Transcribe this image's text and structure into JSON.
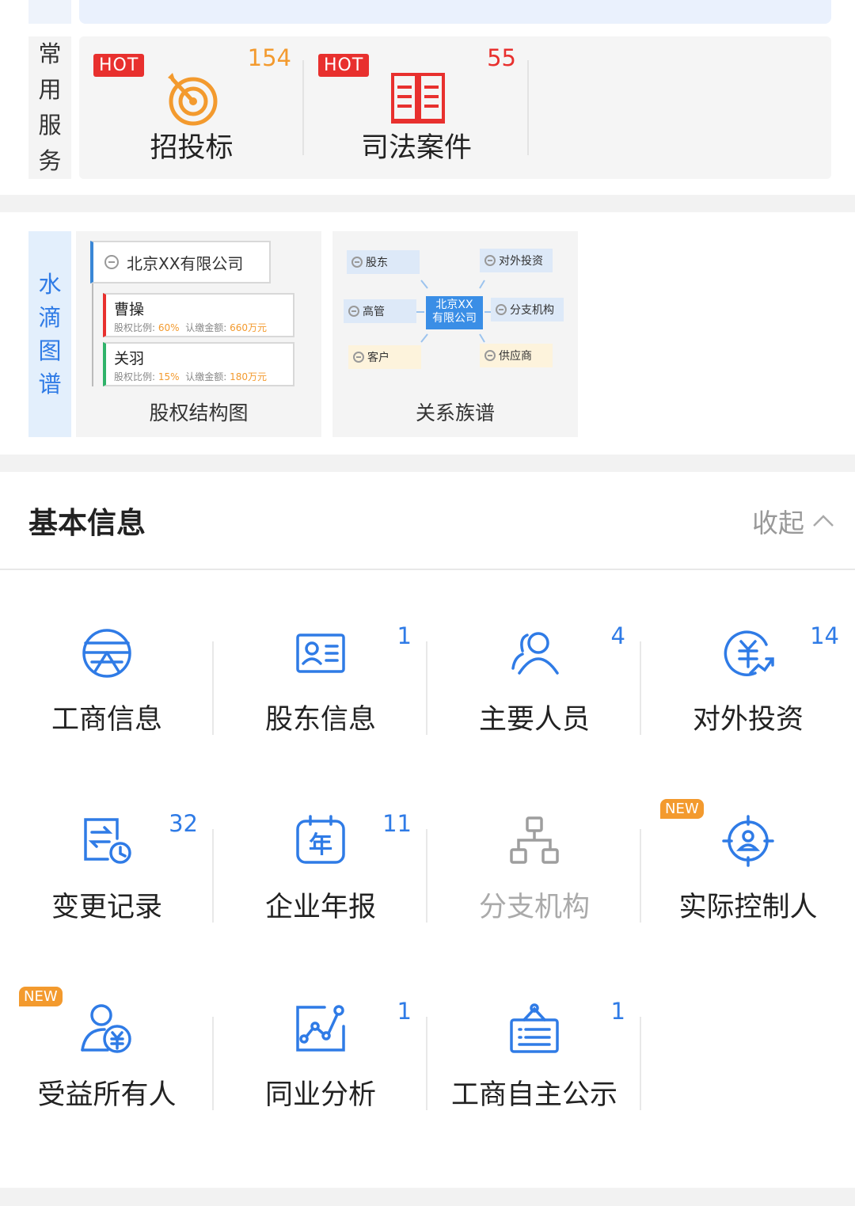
{
  "services": {
    "side_label": [
      "常",
      "用",
      "服",
      "务"
    ],
    "items": [
      {
        "name": "招投标",
        "badge": "HOT",
        "count": "154",
        "count_color": "#f39a2e",
        "icon": "target-icon"
      },
      {
        "name": "司法案件",
        "badge": "HOT",
        "count": "55",
        "count_color": "#e8302e",
        "icon": "law-book-icon"
      }
    ]
  },
  "graph": {
    "side_label": [
      "水",
      "滴",
      "图",
      "谱"
    ],
    "equity": {
      "caption": "股权结构图",
      "root": "北京XX有限公司",
      "holders": [
        {
          "name": "曹操",
          "ratio_label": "股权比例:",
          "ratio": "60%",
          "amount_label": "认缴金额:",
          "amount": "660万元",
          "accent": "#e8302e"
        },
        {
          "name": "关羽",
          "ratio_label": "股权比例:",
          "ratio": "15%",
          "amount_label": "认缴金额:",
          "amount": "180万元",
          "accent": "#2fb36a"
        }
      ]
    },
    "relation": {
      "caption": "关系族谱",
      "center": [
        "北京XX",
        "有限公司"
      ],
      "nodes": {
        "shareholder": "股东",
        "investment": "对外投资",
        "executive": "高管",
        "branch": "分支机构",
        "customer": "客户",
        "supplier": "供应商"
      }
    }
  },
  "basic": {
    "title": "基本信息",
    "collapse_label": "收起",
    "cells": [
      {
        "label": "工商信息",
        "count": "",
        "icon": "business-info-icon",
        "badge": ""
      },
      {
        "label": "股东信息",
        "count": "1",
        "icon": "id-card-icon",
        "badge": ""
      },
      {
        "label": "主要人员",
        "count": "4",
        "icon": "people-icon",
        "badge": ""
      },
      {
        "label": "对外投资",
        "count": "14",
        "icon": "investment-icon",
        "badge": ""
      },
      {
        "label": "变更记录",
        "count": "32",
        "icon": "change-record-icon",
        "badge": ""
      },
      {
        "label": "企业年报",
        "count": "11",
        "icon": "annual-report-icon",
        "badge": ""
      },
      {
        "label": "分支机构",
        "count": "",
        "icon": "branch-org-icon",
        "badge": "",
        "disabled": true
      },
      {
        "label": "实际控制人",
        "count": "",
        "icon": "controller-icon",
        "badge": "NEW"
      },
      {
        "label": "受益所有人",
        "count": "",
        "icon": "beneficiary-icon",
        "badge": "NEW"
      },
      {
        "label": "同业分析",
        "count": "1",
        "icon": "industry-analysis-icon",
        "badge": ""
      },
      {
        "label": "工商自主公示",
        "count": "1",
        "icon": "public-notice-icon",
        "badge": ""
      }
    ]
  }
}
